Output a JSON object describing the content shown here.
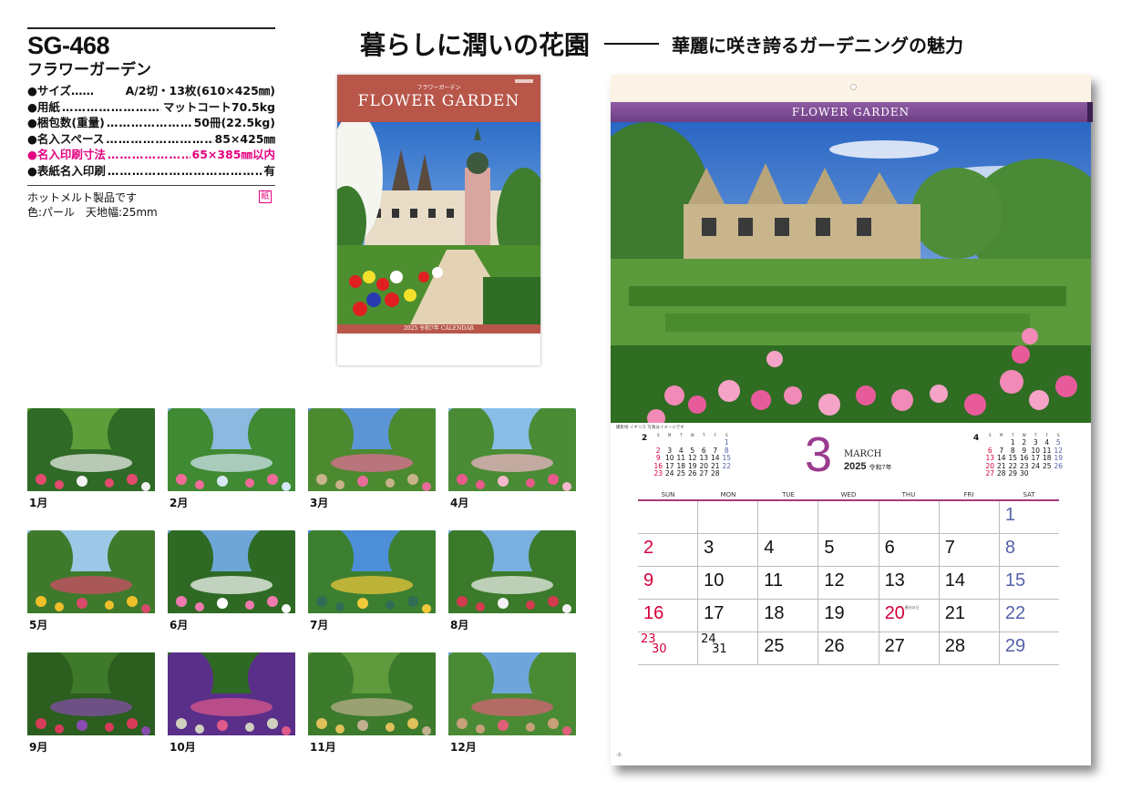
{
  "product": {
    "code": "SG-468",
    "name": "フラワーガーデン",
    "specs": [
      {
        "label": "●サイズ……",
        "value": "A/2切・13枚(610×425㎜)",
        "pink": false,
        "dots": false
      },
      {
        "label": "●用紙",
        "value": "マットコート70.5kg",
        "pink": false,
        "dots": true
      },
      {
        "label": "●梱包数(重量)",
        "value": "50冊(22.5kg)",
        "pink": false,
        "dots": true
      },
      {
        "label": "●名入スペース",
        "value": "85×425㎜",
        "pink": false,
        "dots": true
      },
      {
        "label": "●名入印刷寸法",
        "value": "65×385㎜以内",
        "pink": true,
        "dots": true
      },
      {
        "label": "●表紙名入印刷",
        "value": "有",
        "pink": false,
        "dots": true
      }
    ],
    "note1": "ホットメルト製品です",
    "note2": "色:パール　天地幅:25mm",
    "paper_badge": "紙"
  },
  "headline": {
    "main": "暮らしに潤いの花園",
    "sub": "華麗に咲き誇るガーデニングの魅力"
  },
  "cover": {
    "kana": "フラワーガーデン",
    "title": "FLOWER GARDEN",
    "bottom": "2025 令和7年 CALENDAR"
  },
  "thumbnails": [
    {
      "label": "1月",
      "scene": "sunken-garden"
    },
    {
      "label": "2月",
      "scene": "fountain-garden"
    },
    {
      "label": "3月",
      "scene": "manor-garden"
    },
    {
      "label": "4月",
      "scene": "flower-arches"
    },
    {
      "label": "5月",
      "scene": "cottage-garden"
    },
    {
      "label": "6月",
      "scene": "rose-walk"
    },
    {
      "label": "7月",
      "scene": "water-garden"
    },
    {
      "label": "8月",
      "scene": "flower-beds"
    },
    {
      "label": "9月",
      "scene": "planters"
    },
    {
      "label": "10月",
      "scene": "arbor-path"
    },
    {
      "label": "11月",
      "scene": "fountain-beds"
    },
    {
      "label": "12月",
      "scene": "terrace-garden"
    }
  ],
  "calendar": {
    "band_title": "FLOWER GARDEN",
    "caption": "撮影地 イギリス 写真はイメージです",
    "month_number": "3",
    "month_name": "MARCH",
    "year": "2025",
    "era": "令和7年",
    "weekday_headers": [
      "SUN",
      "MON",
      "TUE",
      "WED",
      "THU",
      "FRI",
      "SAT"
    ],
    "mini_weekdays": [
      "S",
      "M",
      "T",
      "W",
      "T",
      "F",
      "S"
    ],
    "prev_month": {
      "number": "2",
      "weeks": [
        [
          "",
          "",
          "",
          "",
          "",
          "",
          "1"
        ],
        [
          "2",
          "3",
          "4",
          "5",
          "6",
          "7",
          "8"
        ],
        [
          "9",
          "10",
          "11",
          "12",
          "13",
          "14",
          "15"
        ],
        [
          "16",
          "17",
          "18",
          "19",
          "20",
          "21",
          "22"
        ],
        [
          "23",
          "24",
          "25",
          "26",
          "27",
          "28",
          ""
        ]
      ]
    },
    "next_month": {
      "number": "4",
      "weeks": [
        [
          "",
          "",
          "1",
          "2",
          "3",
          "4",
          "5"
        ],
        [
          "6",
          "7",
          "8",
          "9",
          "10",
          "11",
          "12"
        ],
        [
          "13",
          "14",
          "15",
          "16",
          "17",
          "18",
          "19"
        ],
        [
          "20",
          "21",
          "22",
          "23",
          "24",
          "25",
          "26"
        ],
        [
          "27",
          "28",
          "29",
          "30",
          "",
          "",
          ""
        ]
      ]
    },
    "weeks": [
      [
        "",
        "",
        "",
        "",
        "",
        "",
        "1"
      ],
      [
        "2",
        "3",
        "4",
        "5",
        "6",
        "7",
        "8"
      ],
      [
        "9",
        "10",
        "11",
        "12",
        "13",
        "14",
        "15"
      ],
      [
        "16",
        "17",
        "18",
        "19",
        "20",
        "21",
        "22"
      ],
      [
        "23/30",
        "24/31",
        "25",
        "26",
        "27",
        "28",
        "29"
      ]
    ],
    "holidays": [
      "20"
    ],
    "holiday_name": "春分の日",
    "footer_page": "-3-"
  }
}
